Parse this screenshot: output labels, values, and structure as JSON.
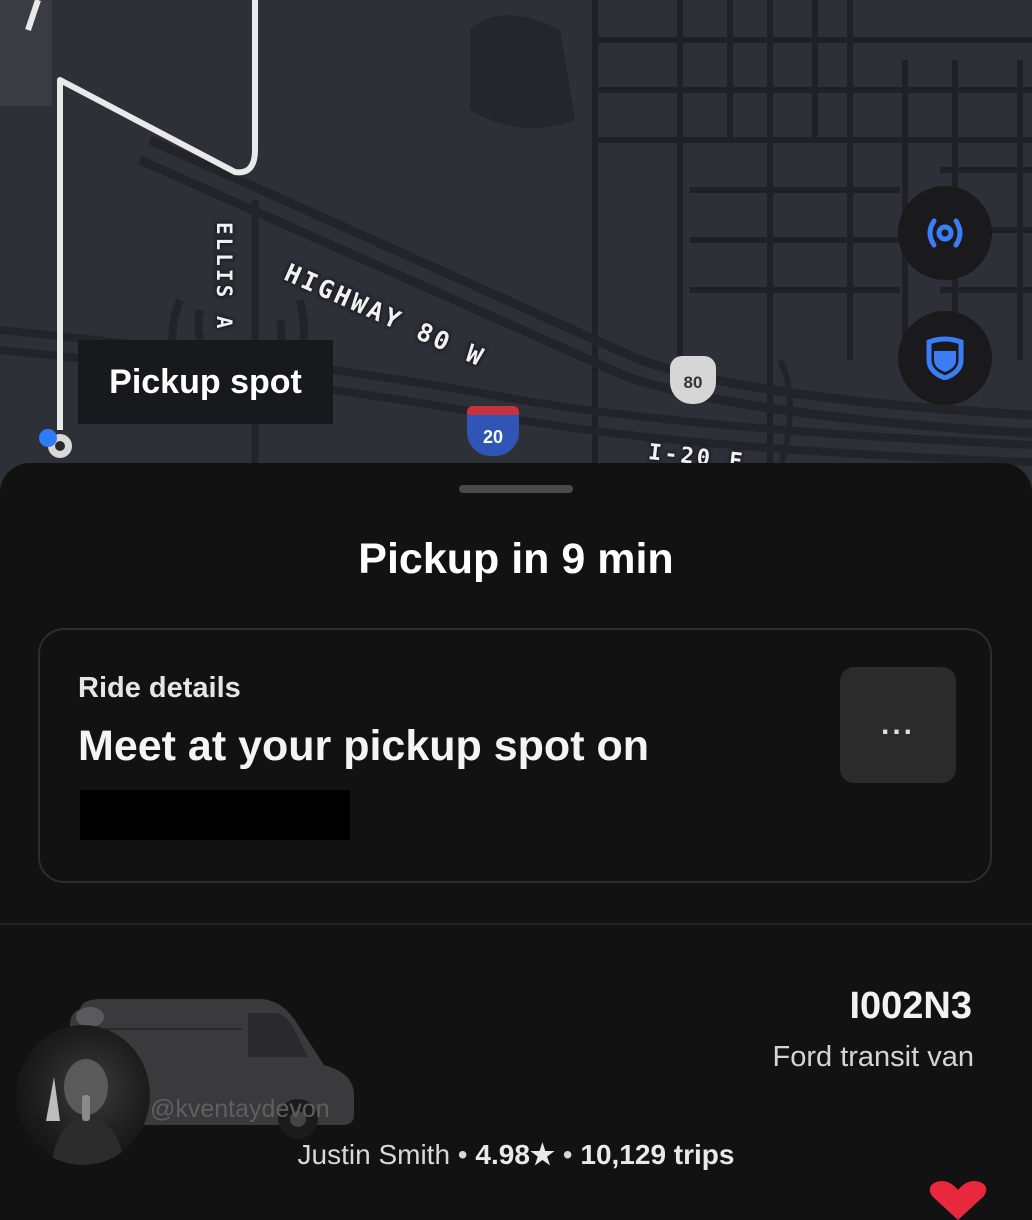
{
  "map": {
    "labels": {
      "highway": "HIGHWAY 80 W",
      "street": "ELLIS A",
      "interstate_road": "I-20 E"
    },
    "shields": {
      "us_route": "80",
      "interstate": "20"
    },
    "pickup_tag": "Pickup spot",
    "buttons": [
      {
        "name": "location-broadcast",
        "icon": "radar-icon",
        "color": "#3c7cf5"
      },
      {
        "name": "safety",
        "icon": "shield-icon",
        "color": "#3c7cf5"
      }
    ]
  },
  "sheet": {
    "title": "Pickup in 9 min",
    "ride_details": {
      "label": "Ride details",
      "text": "Meet at your pickup spot on",
      "more": "..."
    },
    "driver": {
      "plate": "I002N3",
      "vehicle": "Ford transit van",
      "watermark": "@kventaydevon",
      "name": "Justin Smith",
      "separator": "•",
      "rating": "4.98★",
      "trips": "10,129 trips"
    }
  },
  "colors": {
    "background": "#121212",
    "map": "#2e3038",
    "accent": "#3c7cf5",
    "heart": "#e8283c"
  }
}
